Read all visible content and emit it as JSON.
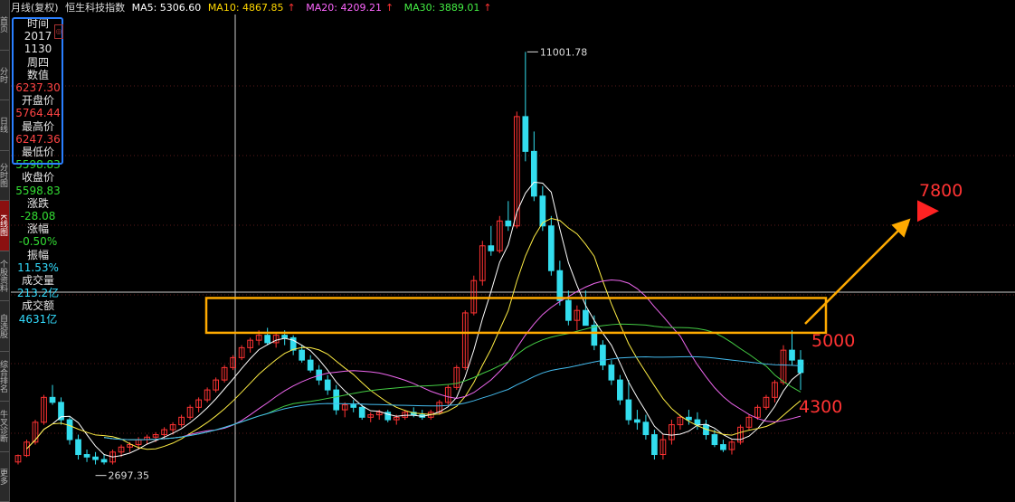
{
  "header": {
    "period": "月线(复权)",
    "symbol": "恒生科技指数",
    "ma5": "MA5: 5306.60",
    "ma10": "MA10: 4867.85",
    "ma20": "MA20: 4209.21",
    "ma30": "MA30: 3889.01",
    "arrow": "↑"
  },
  "left_tabs": [
    "首页",
    "分时",
    "日线",
    "分时图",
    "K线图",
    "个股资料",
    "自选股",
    "综合排名",
    "牛叉诊断",
    "更多"
  ],
  "info_panel": [
    {
      "label": "时间",
      "value": "2017",
      "value2": "1130",
      "color": "white"
    },
    {
      "label": "周四",
      "value": "",
      "color": "white"
    },
    {
      "label": "数值",
      "value": "6237.30",
      "color": "red"
    },
    {
      "label": "开盘价",
      "value": "5764.44",
      "color": "red"
    },
    {
      "label": "最高价",
      "value": "6247.36",
      "color": "red"
    },
    {
      "label": "最低价",
      "value": "5598.83",
      "color": "green"
    },
    {
      "label": "收盘价",
      "value": "5598.83",
      "color": "green"
    },
    {
      "label": "涨跌",
      "value": "-28.08",
      "color": "green"
    },
    {
      "label": "涨幅",
      "value": "-0.50%",
      "color": "green"
    },
    {
      "label": "振幅",
      "value": "11.53%",
      "color": "cyan"
    },
    {
      "label": "成交量",
      "value": "213.2亿",
      "color": "cyan"
    },
    {
      "label": "成交额",
      "value": "4631亿",
      "color": "cyan"
    }
  ],
  "chart_data": {
    "type": "candlestick",
    "colors": {
      "up": "#ff3333",
      "down": "#33ddee",
      "ma5": "#ffffff",
      "ma10": "#ffee44",
      "ma20": "#ee66ee",
      "ma30": "#44cc44",
      "ma60": "#44bbee",
      "box": "#ffaa00",
      "target": "#ff2222",
      "trend": "#ffaa00"
    },
    "high_label": "11001.78",
    "low_label": "2697.35",
    "annotations": {
      "target": "7800",
      "resistance": "5000",
      "support": "4300"
    },
    "ohlc": [
      [
        2750,
        2900,
        2700,
        2880
      ],
      [
        2880,
        3200,
        2850,
        3150
      ],
      [
        3150,
        3600,
        3100,
        3550
      ],
      [
        3550,
        4100,
        3500,
        4050
      ],
      [
        4050,
        4300,
        3900,
        3950
      ],
      [
        3950,
        4050,
        3500,
        3600
      ],
      [
        3600,
        3650,
        3100,
        3200
      ],
      [
        3200,
        3300,
        2800,
        2900
      ],
      [
        2900,
        3000,
        2750,
        2850
      ],
      [
        2850,
        2950,
        2700,
        2800
      ],
      [
        2800,
        2900,
        2700,
        2750
      ],
      [
        2750,
        3000,
        2700,
        2950
      ],
      [
        2950,
        3100,
        2850,
        3050
      ],
      [
        3050,
        3150,
        2950,
        3100
      ],
      [
        3100,
        3250,
        3000,
        3200
      ],
      [
        3200,
        3300,
        3100,
        3250
      ],
      [
        3250,
        3350,
        3150,
        3300
      ],
      [
        3300,
        3450,
        3200,
        3400
      ],
      [
        3400,
        3550,
        3300,
        3500
      ],
      [
        3500,
        3700,
        3450,
        3650
      ],
      [
        3650,
        3900,
        3600,
        3850
      ],
      [
        3850,
        4050,
        3750,
        4000
      ],
      [
        4000,
        4250,
        3950,
        4200
      ],
      [
        4200,
        4450,
        4150,
        4400
      ],
      [
        4400,
        4700,
        4350,
        4650
      ],
      [
        4650,
        4900,
        4600,
        4850
      ],
      [
        4850,
        5100,
        4800,
        5050
      ],
      [
        5050,
        5250,
        4950,
        5200
      ],
      [
        5200,
        5400,
        5100,
        5300
      ],
      [
        5300,
        5450,
        5100,
        5150
      ],
      [
        5150,
        5350,
        5050,
        5300
      ],
      [
        5300,
        5400,
        5100,
        5250
      ],
      [
        5250,
        5300,
        4900,
        5000
      ],
      [
        5000,
        5100,
        4750,
        4800
      ],
      [
        4800,
        4900,
        4550,
        4600
      ],
      [
        4600,
        4700,
        4300,
        4400
      ],
      [
        4400,
        4500,
        4100,
        4200
      ],
      [
        4200,
        4300,
        3700,
        3800
      ],
      [
        3800,
        3950,
        3650,
        3900
      ],
      [
        3900,
        4000,
        3750,
        3850
      ],
      [
        3850,
        3900,
        3600,
        3650
      ],
      [
        3650,
        3750,
        3550,
        3700
      ],
      [
        3700,
        3800,
        3600,
        3750
      ],
      [
        3750,
        3800,
        3550,
        3600
      ],
      [
        3600,
        3700,
        3500,
        3650
      ],
      [
        3650,
        3800,
        3600,
        3750
      ],
      [
        3750,
        3850,
        3650,
        3700
      ],
      [
        3700,
        3800,
        3600,
        3650
      ],
      [
        3650,
        3800,
        3600,
        3750
      ],
      [
        3750,
        4000,
        3700,
        3950
      ],
      [
        3950,
        4300,
        3900,
        4250
      ],
      [
        4250,
        4700,
        4200,
        4650
      ],
      [
        4650,
        5800,
        4600,
        5750
      ],
      [
        5750,
        6500,
        5700,
        6400
      ],
      [
        6400,
        7200,
        6300,
        7100
      ],
      [
        7100,
        7500,
        6900,
        7000
      ],
      [
        7000,
        7700,
        6950,
        7600
      ],
      [
        7600,
        8000,
        7400,
        7500
      ],
      [
        7500,
        9800,
        7450,
        9700
      ],
      [
        9700,
        11001.78,
        8800,
        9000
      ],
      [
        9000,
        9400,
        8000,
        8100
      ],
      [
        8100,
        8300,
        7400,
        7500
      ],
      [
        7500,
        7700,
        6500,
        6600
      ],
      [
        6600,
        6800,
        5900,
        6000
      ],
      [
        6000,
        6200,
        5500,
        5600
      ],
      [
        5600,
        5900,
        5400,
        5800
      ],
      [
        5800,
        6200,
        5500,
        5500
      ],
      [
        5500,
        5700,
        5000,
        5100
      ],
      [
        5100,
        5200,
        4600,
        4700
      ],
      [
        4700,
        4800,
        4300,
        4400
      ],
      [
        4400,
        4500,
        3900,
        4000
      ],
      [
        4000,
        4400,
        3500,
        3600
      ],
      [
        3600,
        3800,
        3400,
        3550
      ],
      [
        3550,
        3700,
        3200,
        3300
      ],
      [
        3300,
        3400,
        2800,
        2900
      ],
      [
        2900,
        3300,
        2800,
        3200
      ],
      [
        3200,
        3600,
        3100,
        3500
      ],
      [
        3500,
        3700,
        3400,
        3650
      ],
      [
        3650,
        3800,
        3500,
        3600
      ],
      [
        3600,
        3750,
        3400,
        3500
      ],
      [
        3500,
        3600,
        3200,
        3300
      ],
      [
        3300,
        3400,
        3050,
        3100
      ],
      [
        3100,
        3200,
        2950,
        3000
      ],
      [
        3000,
        3200,
        2900,
        3150
      ],
      [
        3150,
        3500,
        3100,
        3450
      ],
      [
        3450,
        3700,
        3400,
        3650
      ],
      [
        3650,
        3900,
        3600,
        3850
      ],
      [
        3850,
        4100,
        3800,
        4050
      ],
      [
        4050,
        4400,
        3950,
        4350
      ],
      [
        4350,
        5100,
        4300,
        5000
      ],
      [
        5000,
        5400,
        4700,
        4800
      ],
      [
        4800,
        5000,
        4200,
        4550
      ]
    ]
  }
}
